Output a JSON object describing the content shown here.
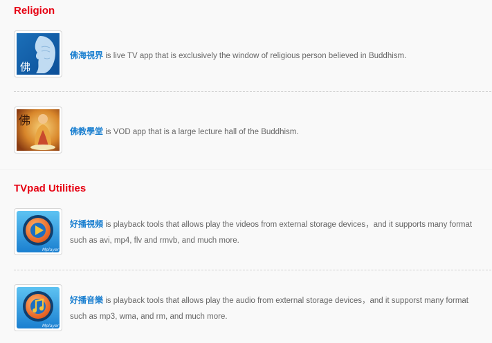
{
  "sections": {
    "religion": {
      "title": "Religion",
      "items": [
        {
          "name": "佛海視界",
          "description": " is live TV app that is exclusively the window of religious person believed in Buddhism."
        },
        {
          "name": "佛教學堂",
          "description": " is VOD app that is a large lecture hall of the Buddhism."
        }
      ]
    },
    "utilities": {
      "title": "TVpad Utilities",
      "items": [
        {
          "name": "好播視頻",
          "description": " is playback tools that allows play the videos from external storage devices，and it supports many format such as avi, mp4, flv and rmvb, and much more.",
          "icon_caption": "Mplayer"
        },
        {
          "name": "好播音樂",
          "description": " is playback tools that allows play the audio from external storage devices，and it supporst many format such as mp3, wma, and rm, and much more.",
          "icon_caption": "Mplayer"
        }
      ]
    }
  },
  "icons": {
    "buddha_glyph": "佛",
    "colors": {
      "title_red": "#e60012",
      "app_link_blue": "#1a7fd0",
      "text_gray": "#666666"
    },
    "names": [
      "buddha-face-icon",
      "buddha-statue-icon",
      "video-player-icon",
      "music-player-icon"
    ]
  }
}
